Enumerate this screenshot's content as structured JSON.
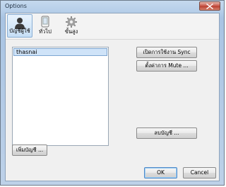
{
  "window": {
    "title": "Options"
  },
  "toolbar": {
    "items": [
      {
        "label": "บัญชีผู้ใช้",
        "icon": "user-icon",
        "selected": true
      },
      {
        "label": "ทั่วไป",
        "icon": "device-icon",
        "selected": false
      },
      {
        "label": "ขั้นสูง",
        "icon": "gear-icon",
        "selected": false
      }
    ]
  },
  "accounts": {
    "items": [
      "thasnai"
    ],
    "selected_index": 0
  },
  "buttons": {
    "enable_sync": "เปิดการใช้งาน Sync",
    "mute_settings": "ตั้งค่าการ Mute ...",
    "delete_account": "ลบบัญชี ...",
    "add_account": "เพิ่มบัญชี ...",
    "ok": "OK",
    "cancel": "Cancel"
  },
  "colors": {
    "selection": "#cfe3f8",
    "window_frame": "#b7cfe9",
    "close": "#c9574a"
  }
}
